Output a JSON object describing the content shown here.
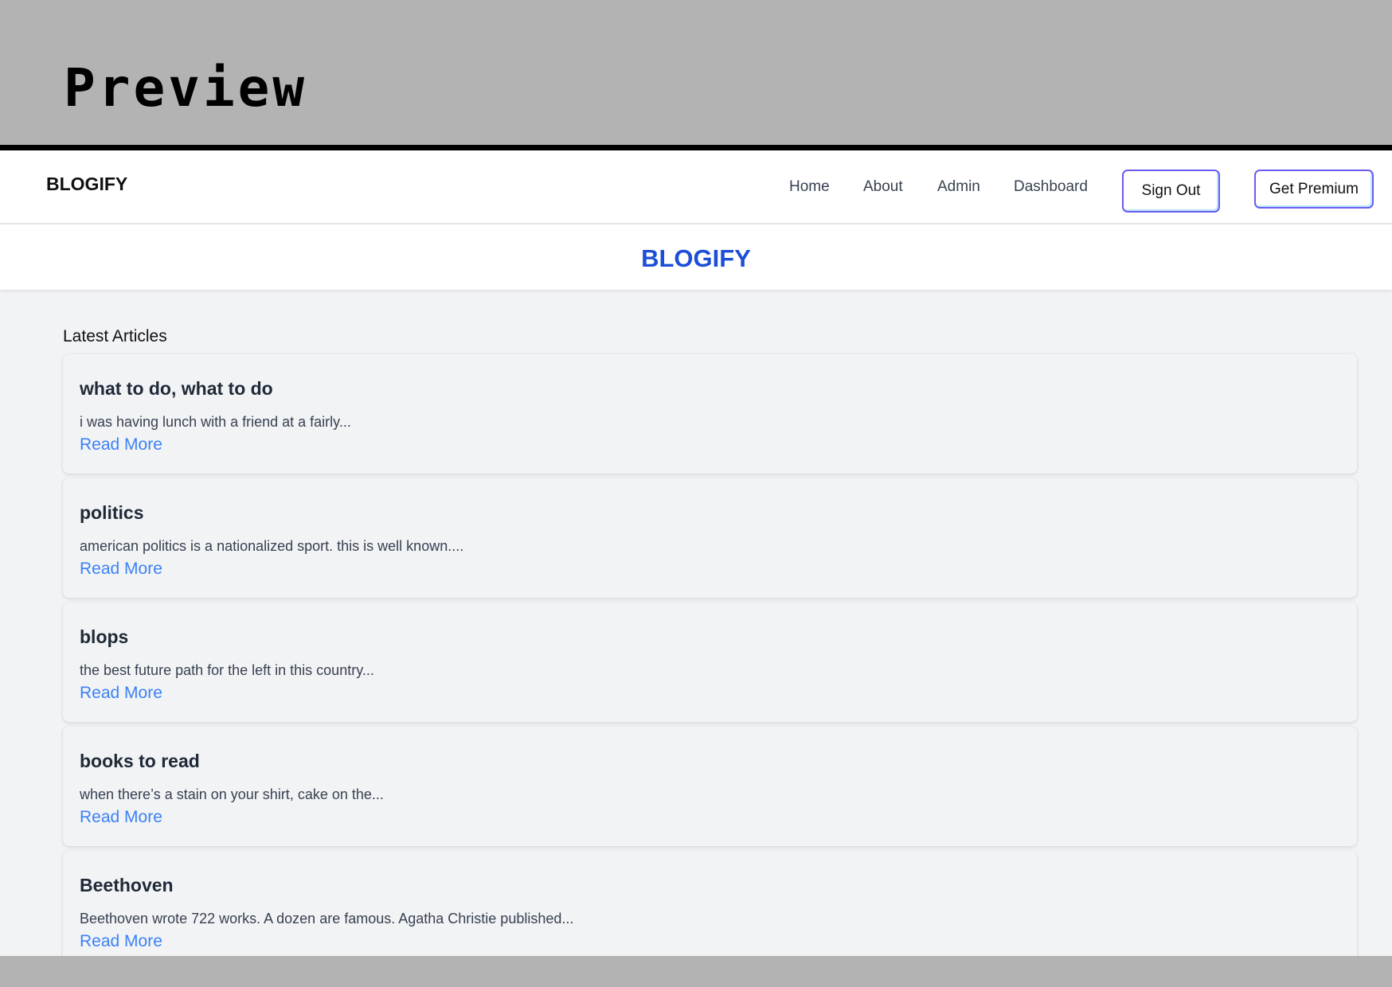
{
  "preview": {
    "title": "Preview"
  },
  "navbar": {
    "brand": "BLOGIFY",
    "links": [
      "Home",
      "About",
      "Admin",
      "Dashboard"
    ],
    "sign_out": "Sign Out",
    "get_premium": "Get Premium"
  },
  "hero": {
    "title": "BLOGIFY"
  },
  "main": {
    "section_title": "Latest Articles",
    "articles": [
      {
        "title": "what to do, what to do",
        "excerpt": "i was having lunch with a friend at a fairly...",
        "link": "Read More"
      },
      {
        "title": "politics",
        "excerpt": "american politics is a nationalized sport. this is well known....",
        "link": "Read More"
      },
      {
        "title": "blops",
        "excerpt": "the best future path for the left in this country...",
        "link": "Read More"
      },
      {
        "title": "books to read",
        "excerpt": "when there’s a stain on your shirt, cake on the...",
        "link": "Read More"
      },
      {
        "title": "Beethoven",
        "excerpt": "Beethoven wrote 722 works. A dozen are famous. Agatha Christie published...",
        "link": "Read More"
      }
    ]
  },
  "colors": {
    "accent_blue": "#1d4ed8",
    "link_blue": "#3b82f6",
    "button_border": "#6a5cf0"
  }
}
